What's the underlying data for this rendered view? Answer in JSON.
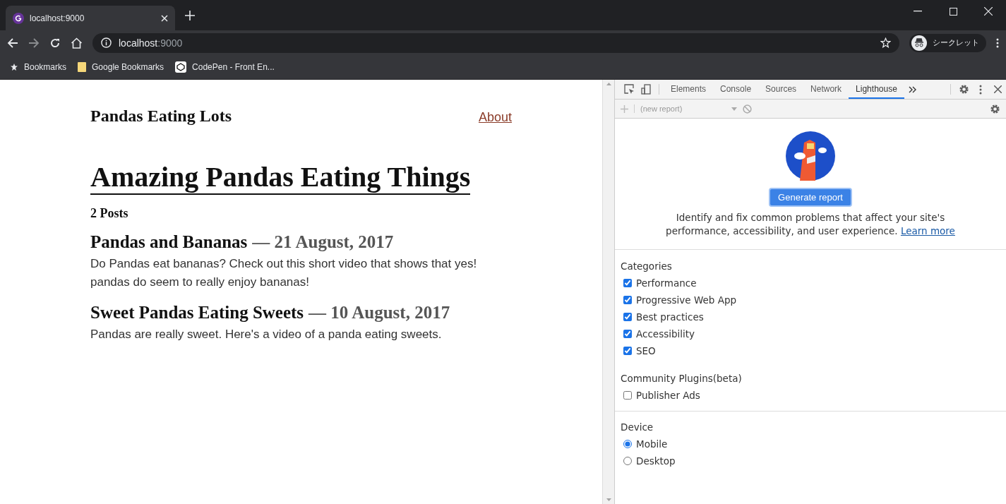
{
  "browser": {
    "tab": {
      "title": "localhost:9000"
    },
    "address": {
      "host": "localhost",
      "port": ":9000"
    },
    "profile": "シークレット",
    "bookmarks": [
      {
        "label": "Bookmarks",
        "kind": "star"
      },
      {
        "label": "Google Bookmarks",
        "kind": "folder"
      },
      {
        "label": "CodePen - Front En...",
        "kind": "site"
      }
    ]
  },
  "page": {
    "site_title": "Pandas Eating Lots",
    "nav_link": "About",
    "heading": "Amazing Pandas Eating Things",
    "post_count": "2 Posts",
    "posts": [
      {
        "title": "Pandas and Bananas",
        "date": "— 21 August, 2017",
        "excerpt": "Do Pandas eat bananas? Check out this short video that shows that yes! pandas do seem to really enjoy bananas!"
      },
      {
        "title": "Sweet Pandas Eating Sweets",
        "date": "— 10 August, 2017",
        "excerpt": "Pandas are really sweet. Here's a video of a panda eating sweets."
      }
    ]
  },
  "devtools": {
    "tabs": [
      {
        "label": "Elements",
        "selected": false
      },
      {
        "label": "Console",
        "selected": false
      },
      {
        "label": "Sources",
        "selected": false
      },
      {
        "label": "Network",
        "selected": false
      },
      {
        "label": "Lighthouse",
        "selected": true
      }
    ],
    "report_select": "(new report)",
    "generate_button": "Generate report",
    "description": "Identify and fix common problems that affect your site's performance, accessibility, and user experience.",
    "learn_more": "Learn more",
    "sections": [
      {
        "title": "Categories",
        "kind": "checkbox",
        "divider": false,
        "options": [
          {
            "label": "Performance",
            "checked": true
          },
          {
            "label": "Progressive Web App",
            "checked": true
          },
          {
            "label": "Best practices",
            "checked": true
          },
          {
            "label": "Accessibility",
            "checked": true
          },
          {
            "label": "SEO",
            "checked": true
          }
        ]
      },
      {
        "title": "Community Plugins(beta)",
        "kind": "checkbox",
        "divider": false,
        "options": [
          {
            "label": "Publisher Ads",
            "checked": false
          }
        ]
      },
      {
        "title": "Device",
        "kind": "radio",
        "divider": true,
        "options": [
          {
            "label": "Mobile",
            "selected": true
          },
          {
            "label": "Desktop",
            "selected": false
          }
        ]
      }
    ]
  }
}
